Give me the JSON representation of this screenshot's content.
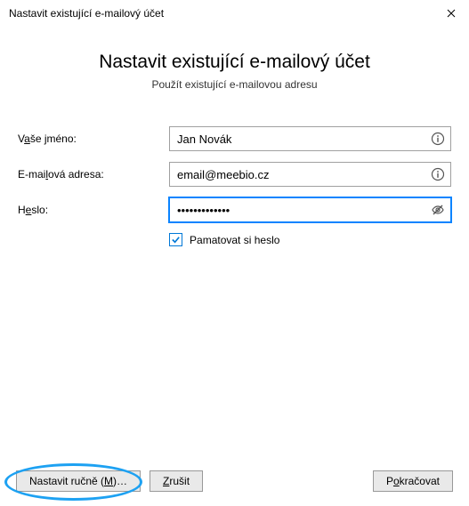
{
  "window": {
    "title": "Nastavit existující e-mailový účet"
  },
  "heading": {
    "title": "Nastavit existující e-mailový účet",
    "subtitle": "Použít existující e-mailovou adresu"
  },
  "form": {
    "name": {
      "label_pre": "V",
      "label_ul": "a",
      "label_post": "še jméno:",
      "value": "Jan Novák"
    },
    "email": {
      "label_pre": "E-mai",
      "label_ul": "l",
      "label_post": "ová adresa:",
      "value": "email@meebio.cz"
    },
    "password": {
      "label_pre": "H",
      "label_ul": "e",
      "label_post": "slo:",
      "value": "•••••••••••••"
    },
    "remember": {
      "label_pre": "P",
      "label_ul": "a",
      "label_post": "matovat si heslo",
      "checked": true
    }
  },
  "buttons": {
    "manual_pre": "Nastavit ručně (",
    "manual_ul": "M",
    "manual_post": ")…",
    "cancel_pre": "",
    "cancel_ul": "Z",
    "cancel_post": "rušit",
    "continue_pre": "P",
    "continue_ul": "o",
    "continue_post": "kračovat"
  }
}
